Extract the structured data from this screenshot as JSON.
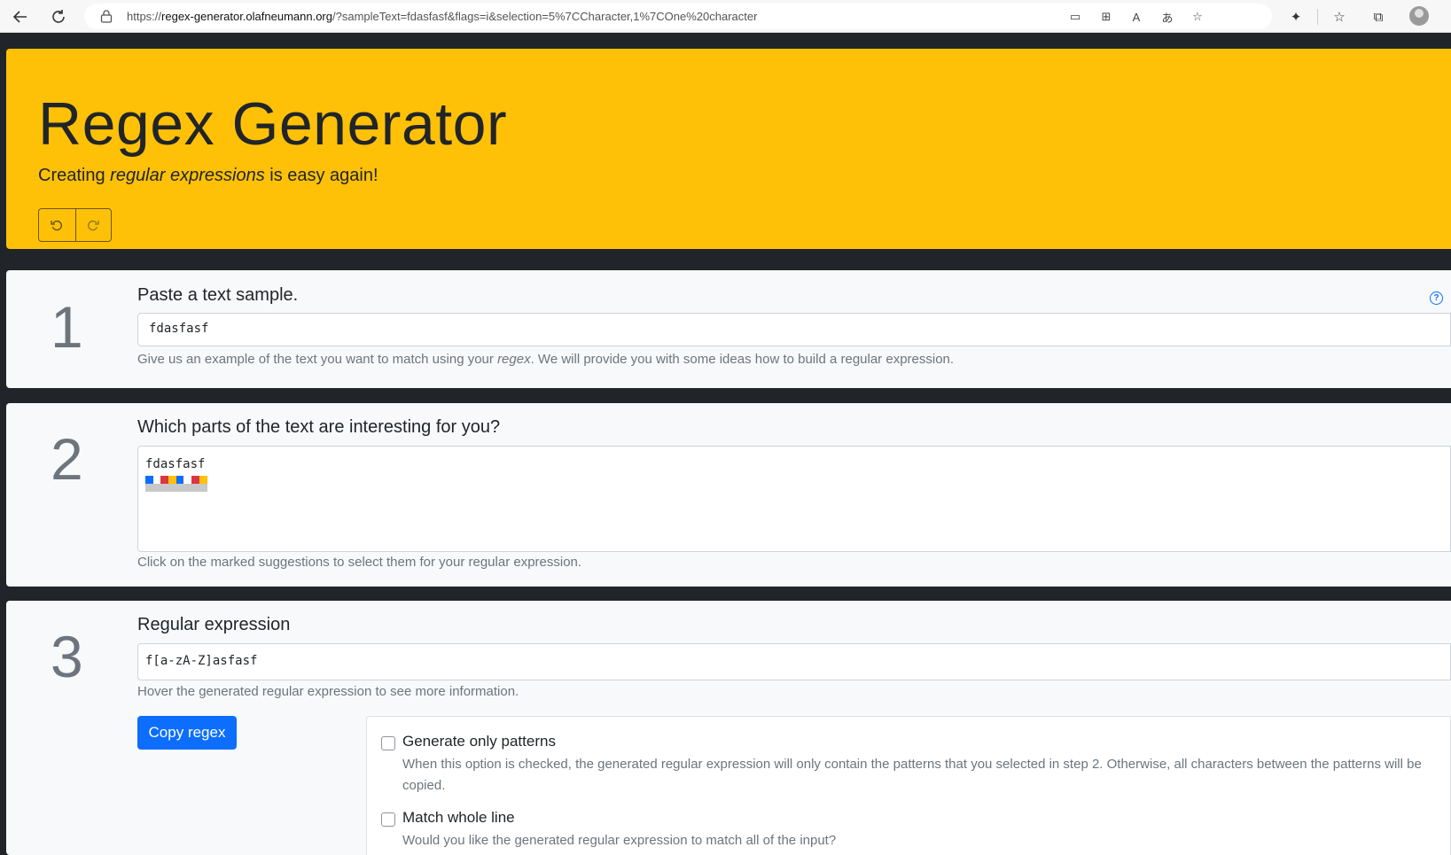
{
  "browser": {
    "url_prefix": "https://",
    "url_host": "regex-generator.olafneumann.org",
    "url_rest": "/?sampleText=fdasfasf&flags=i&selection=5%7CCharacter,1%7COne%20character"
  },
  "hero": {
    "title": "Regex Generator",
    "subtitle_before": "Creating ",
    "subtitle_em": "regular expressions",
    "subtitle_after": " is easy again!"
  },
  "step1": {
    "number": "1",
    "title": "Paste a text sample.",
    "input_value": "fdasfasf",
    "help_before": "Give us an example of the text you want to match using your ",
    "help_em": "regex",
    "help_after": ". We will provide you with some ideas how to build a regular expression."
  },
  "step2": {
    "number": "2",
    "title": "Which parts of the text are interesting for you?",
    "sample_text": "fdasfasf",
    "mark_colors": [
      "#0d6efd",
      "#ffffff",
      "#dc3545",
      "#ffc107",
      "#0d6efd",
      "#ffffff",
      "#dc3545",
      "#ffc107"
    ],
    "help": "Click on the marked suggestions to select them for your regular expression."
  },
  "step3": {
    "number": "3",
    "title": "Regular expression",
    "regex_value": "f[a-zA-Z]asfasf",
    "help": "Hover the generated regular expression to see more information.",
    "copy_button": "Copy regex"
  },
  "options": {
    "only_patterns_label": "Generate only patterns",
    "only_patterns_desc": "When this option is checked, the generated regular expression will only contain the patterns that you selected in step 2. Otherwise, all characters between the patterns will be copied.",
    "whole_line_label": "Match whole line",
    "whole_line_desc": "Would you like the generated regular expression to match all of the input?"
  }
}
